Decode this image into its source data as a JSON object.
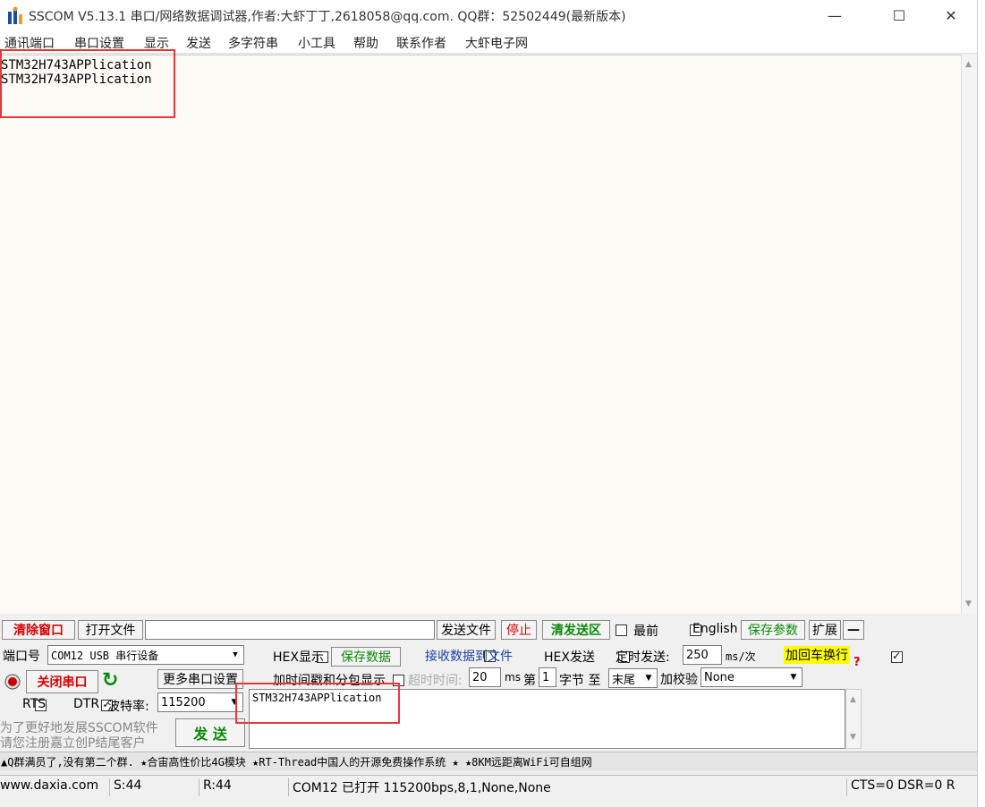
{
  "window": {
    "title": "SSCOM V5.13.1 串口/网络数据调试器,作者:大虾丁丁,2618058@qq.com. QQ群：52502449(最新版本)",
    "minimize": "—",
    "maximize": "☐",
    "close": "✕"
  },
  "menu": [
    "通讯端口",
    "串口设置",
    "显示",
    "发送",
    "多字符串",
    "小工具",
    "帮助",
    "联系作者",
    "大虾电子网"
  ],
  "receive": {
    "lines": [
      "STM32H743APPlication",
      "STM32H743APPlication"
    ]
  },
  "toolbar": {
    "clear_window": "清除窗口",
    "open_file": "打开文件",
    "file_path": "",
    "send_file": "发送文件",
    "stop": "停止",
    "clear_send": "清发送区",
    "topmost": "最前",
    "english": "English",
    "save_params": "保存参数",
    "expand": "扩展",
    "collapse": "—"
  },
  "port": {
    "port_label": "端口号",
    "port_value": "COM12 USB 串行设备",
    "close_port": "关闭串口",
    "more_settings": "更多串口设置",
    "rts": "RTS",
    "dtr": "DTR",
    "baud_label": "波特率:",
    "baud_value": "115200"
  },
  "options": {
    "hex_display": "HEX显示",
    "save_data": "保存数据",
    "recv_to_file": "接收数据到文件",
    "hex_send": "HEX发送",
    "timed_send": "定时发送:",
    "interval": "250",
    "interval_unit": "ms/次",
    "add_crlf": "加回车换行",
    "add_timestamp": "加时间戳和分包显示.",
    "timeout_label": "超时时间:",
    "timeout_value": "20",
    "timeout_unit": "ms",
    "byte_prefix": "第",
    "byte_index": "1",
    "byte_suffix": "字节 至",
    "end_select": "末尾",
    "checksum_label": "加校验",
    "checksum_value": "None",
    "help": "?"
  },
  "send": {
    "text": "STM32H743APPlication",
    "button": "发 送",
    "promo_line1": "为了更好地发展SSCOM软件",
    "promo_line2": "请您注册嘉立创P结尾客户"
  },
  "ticker": "▲Q群满员了,没有第二个群. ★合宙高性价比4G模块 ★RT-Thread中国人的开源免费操作系统 ★ ★8KM远距离WiFi可自组网",
  "status": {
    "site": "www.daxia.com",
    "sent": "S:44",
    "received": "R:44",
    "port_state": "COM12 已打开  115200bps,8,1,None,None",
    "lines": "CTS=0 DSR=0 R"
  },
  "colors": {
    "highlight_box": "#e8373c",
    "receive_bg": "#fdfaf5",
    "crlf_bg": "#ffff00"
  }
}
